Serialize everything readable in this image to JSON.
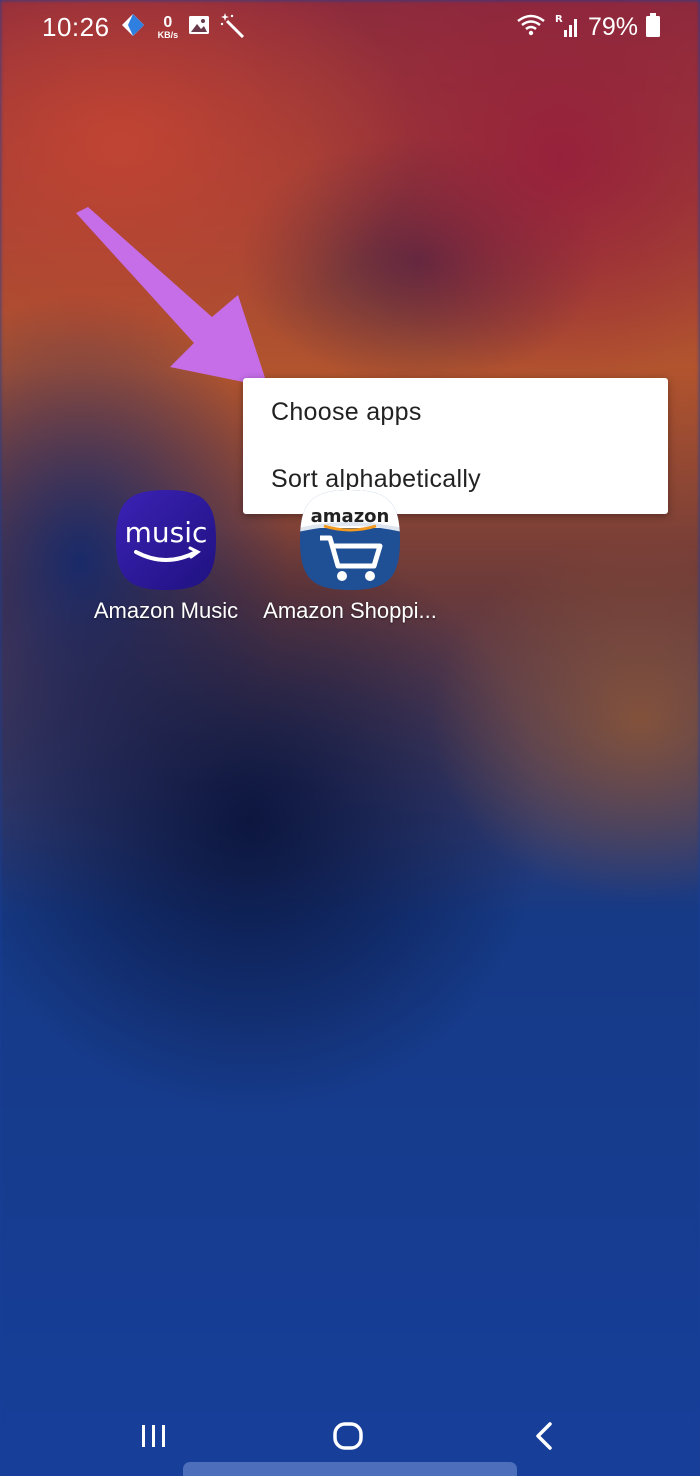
{
  "status_bar": {
    "time": "10:26",
    "speed_value": "0",
    "speed_unit": "KB/s",
    "battery_percent": "79%",
    "icons_left": [
      "kite-app-icon",
      "image-icon",
      "magic-wand-icon"
    ],
    "icons_right": [
      "wifi-icon",
      "signal-roaming-icon",
      "battery-icon"
    ]
  },
  "context_menu": {
    "items": [
      {
        "label": "Choose apps"
      },
      {
        "label": "Sort alphabetically"
      }
    ]
  },
  "apps": [
    {
      "label": "Amazon Music",
      "icon_text": "music"
    },
    {
      "label": "Amazon Shoppi...",
      "icon_text": "amazon"
    }
  ],
  "annotation": {
    "arrow_color": "#c56ee8"
  },
  "nav_bar": {
    "buttons": [
      "recent-apps-icon",
      "home-icon",
      "back-icon"
    ]
  },
  "colors": {
    "music_icon_bg": "#2e1a9e",
    "menu_bg": "#ffffff",
    "menu_text": "#222222"
  }
}
